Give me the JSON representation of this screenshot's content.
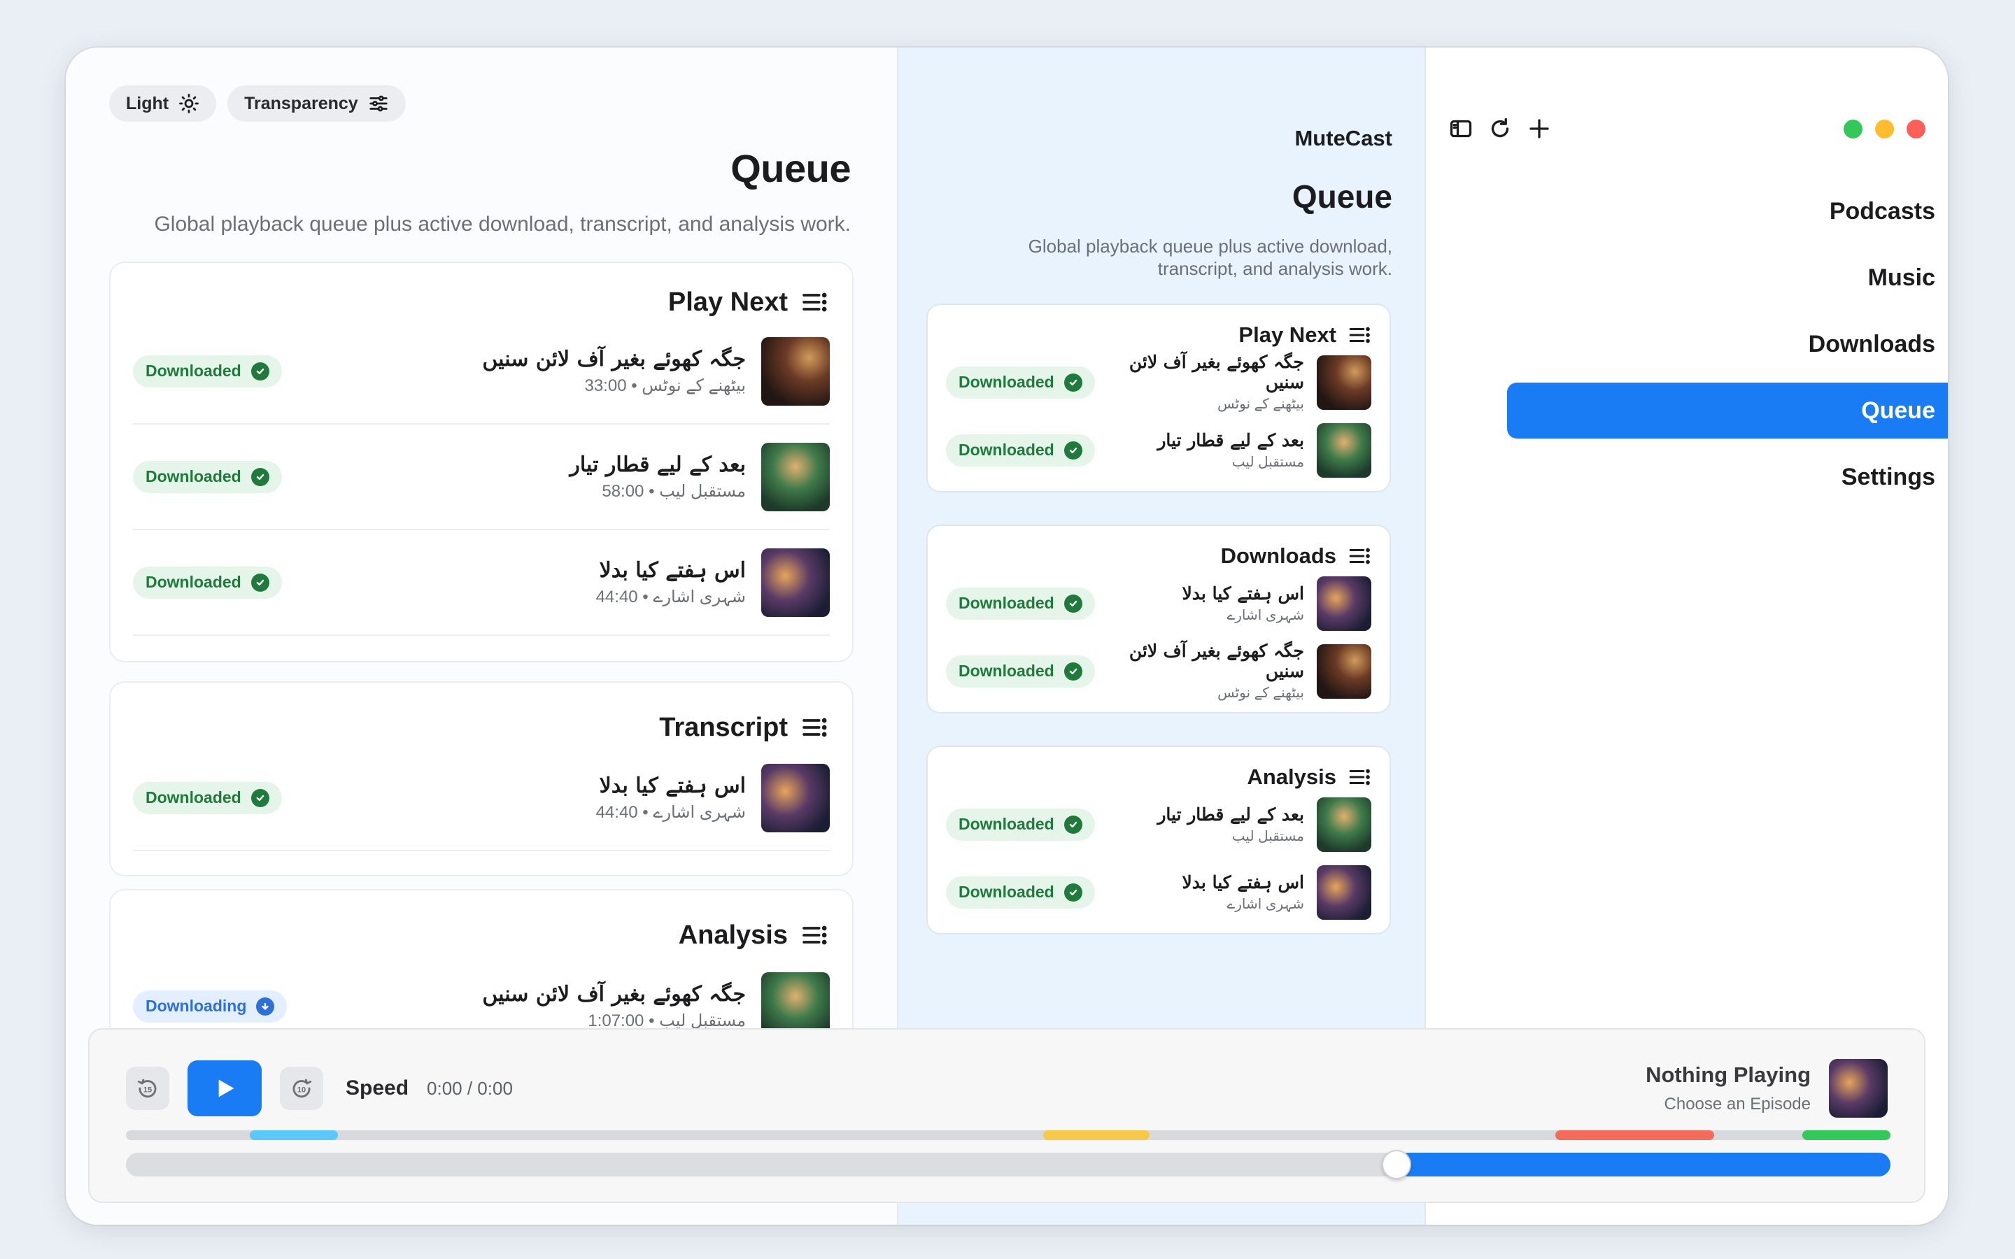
{
  "toolbar": {
    "chip_light": "Light",
    "chip_transparency": "Transparency"
  },
  "left": {
    "title": "Queue",
    "subtitle": "Global playback queue plus active download, transcript, and analysis work.",
    "play_next": {
      "title": "Play Next",
      "items": [
        {
          "status": "Downloaded",
          "title": "جگہ کھوئے بغیر آف لائن سنیں",
          "meta": "بیٹھنے کے نوٹس • 33:00"
        },
        {
          "status": "Downloaded",
          "title": "بعد کے لیے قطار تیار",
          "meta": "مستقبل لیب • 58:00"
        },
        {
          "status": "Downloaded",
          "title": "اس ہفتے کیا بدلا",
          "meta": "شہری اشارے • 44:40"
        }
      ]
    },
    "transcript": {
      "title": "Transcript",
      "items": [
        {
          "status": "Downloaded",
          "title": "اس ہفتے کیا بدلا",
          "meta": "شہری اشارے • 44:40"
        }
      ]
    },
    "analysis": {
      "title": "Analysis",
      "items": [
        {
          "status": "Downloading",
          "title": "جگہ کھوئے بغیر آف لائن سنیں",
          "meta": "مستقبل لیب • 1:07:00"
        }
      ]
    }
  },
  "mid": {
    "app_name": "MuteCast",
    "title": "Queue",
    "subtitle": "Global playback queue plus active download, transcript, and analysis work.",
    "play_next": {
      "title": "Play Next",
      "items": [
        {
          "status": "Downloaded",
          "title": "جگہ کھوئے بغیر آف لائن سنیں",
          "meta": "بیٹھنے کے نوٹس"
        },
        {
          "status": "Downloaded",
          "title": "بعد کے لیے قطار تیار",
          "meta": "مستقبل لیب"
        }
      ]
    },
    "downloads": {
      "title": "Downloads",
      "items": [
        {
          "status": "Downloaded",
          "title": "اس ہفتے کیا بدلا",
          "meta": "شہری اشارے"
        },
        {
          "status": "Downloaded",
          "title": "جگہ کھوئے بغیر آف لائن سنیں",
          "meta": "بیٹھنے کے نوٹس"
        }
      ]
    },
    "analysis": {
      "title": "Analysis",
      "items": [
        {
          "status": "Downloaded",
          "title": "بعد کے لیے قطار تیار",
          "meta": "مستقبل لیب"
        },
        {
          "status": "Downloaded",
          "title": "اس ہفتے کیا بدلا",
          "meta": "شہری اشارے"
        }
      ]
    }
  },
  "sidebar": {
    "items": [
      {
        "label": "Podcasts",
        "icon": "podcasts-icon"
      },
      {
        "label": "Music",
        "icon": "music-icon"
      },
      {
        "label": "Downloads",
        "icon": "downloads-icon"
      },
      {
        "label": "Queue",
        "icon": "queue-icon",
        "active": true
      },
      {
        "label": "Settings",
        "icon": "gear-icon"
      }
    ]
  },
  "player": {
    "speed_label": "Speed",
    "time": "0:00 / 0:00",
    "now_title": "Nothing Playing",
    "now_subtitle": "Choose an Episode",
    "volume_fraction": 0.28,
    "segments": [
      {
        "start": 0.07,
        "end": 0.12,
        "color": "#5ac8fa"
      },
      {
        "start": 0.52,
        "end": 0.58,
        "color": "#f7c948"
      },
      {
        "start": 0.81,
        "end": 0.9,
        "color": "#f26b5b"
      },
      {
        "start": 0.95,
        "end": 1.0,
        "color": "#34c759"
      }
    ]
  },
  "colors": {
    "accent": "#1a7cf4",
    "downloaded_badge": "#1f7a3c",
    "downloading_badge": "#2f6fd8",
    "traffic_green": "#34c759",
    "traffic_yellow": "#febc2e",
    "traffic_red": "#ff5f57"
  }
}
